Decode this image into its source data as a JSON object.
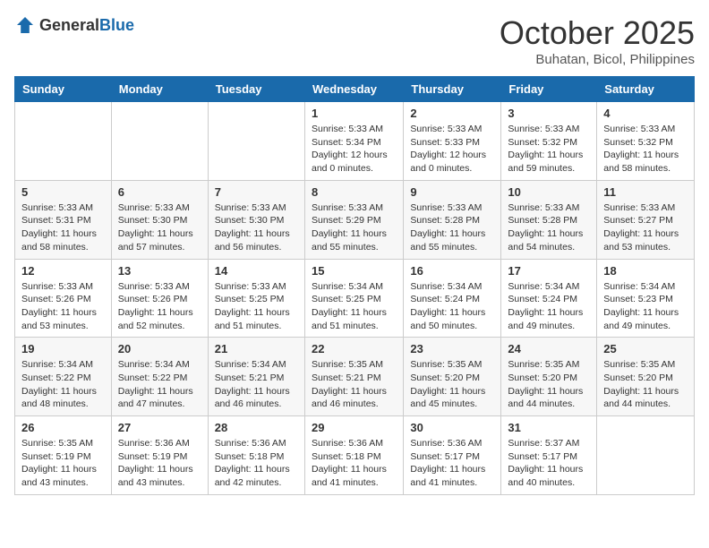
{
  "header": {
    "logo_general": "General",
    "logo_blue": "Blue",
    "month": "October 2025",
    "location": "Buhatan, Bicol, Philippines"
  },
  "weekdays": [
    "Sunday",
    "Monday",
    "Tuesday",
    "Wednesday",
    "Thursday",
    "Friday",
    "Saturday"
  ],
  "weeks": [
    [
      null,
      null,
      null,
      {
        "day": 1,
        "sunrise": "5:33 AM",
        "sunset": "5:34 PM",
        "daylight": "12 hours and 0 minutes"
      },
      {
        "day": 2,
        "sunrise": "5:33 AM",
        "sunset": "5:33 PM",
        "daylight": "12 hours and 0 minutes"
      },
      {
        "day": 3,
        "sunrise": "5:33 AM",
        "sunset": "5:32 PM",
        "daylight": "11 hours and 59 minutes"
      },
      {
        "day": 4,
        "sunrise": "5:33 AM",
        "sunset": "5:32 PM",
        "daylight": "11 hours and 58 minutes"
      }
    ],
    [
      {
        "day": 5,
        "sunrise": "5:33 AM",
        "sunset": "5:31 PM",
        "daylight": "11 hours and 58 minutes"
      },
      {
        "day": 6,
        "sunrise": "5:33 AM",
        "sunset": "5:30 PM",
        "daylight": "11 hours and 57 minutes"
      },
      {
        "day": 7,
        "sunrise": "5:33 AM",
        "sunset": "5:30 PM",
        "daylight": "11 hours and 56 minutes"
      },
      {
        "day": 8,
        "sunrise": "5:33 AM",
        "sunset": "5:29 PM",
        "daylight": "11 hours and 55 minutes"
      },
      {
        "day": 9,
        "sunrise": "5:33 AM",
        "sunset": "5:28 PM",
        "daylight": "11 hours and 55 minutes"
      },
      {
        "day": 10,
        "sunrise": "5:33 AM",
        "sunset": "5:28 PM",
        "daylight": "11 hours and 54 minutes"
      },
      {
        "day": 11,
        "sunrise": "5:33 AM",
        "sunset": "5:27 PM",
        "daylight": "11 hours and 53 minutes"
      }
    ],
    [
      {
        "day": 12,
        "sunrise": "5:33 AM",
        "sunset": "5:26 PM",
        "daylight": "11 hours and 53 minutes"
      },
      {
        "day": 13,
        "sunrise": "5:33 AM",
        "sunset": "5:26 PM",
        "daylight": "11 hours and 52 minutes"
      },
      {
        "day": 14,
        "sunrise": "5:33 AM",
        "sunset": "5:25 PM",
        "daylight": "11 hours and 51 minutes"
      },
      {
        "day": 15,
        "sunrise": "5:34 AM",
        "sunset": "5:25 PM",
        "daylight": "11 hours and 51 minutes"
      },
      {
        "day": 16,
        "sunrise": "5:34 AM",
        "sunset": "5:24 PM",
        "daylight": "11 hours and 50 minutes"
      },
      {
        "day": 17,
        "sunrise": "5:34 AM",
        "sunset": "5:24 PM",
        "daylight": "11 hours and 49 minutes"
      },
      {
        "day": 18,
        "sunrise": "5:34 AM",
        "sunset": "5:23 PM",
        "daylight": "11 hours and 49 minutes"
      }
    ],
    [
      {
        "day": 19,
        "sunrise": "5:34 AM",
        "sunset": "5:22 PM",
        "daylight": "11 hours and 48 minutes"
      },
      {
        "day": 20,
        "sunrise": "5:34 AM",
        "sunset": "5:22 PM",
        "daylight": "11 hours and 47 minutes"
      },
      {
        "day": 21,
        "sunrise": "5:34 AM",
        "sunset": "5:21 PM",
        "daylight": "11 hours and 46 minutes"
      },
      {
        "day": 22,
        "sunrise": "5:35 AM",
        "sunset": "5:21 PM",
        "daylight": "11 hours and 46 minutes"
      },
      {
        "day": 23,
        "sunrise": "5:35 AM",
        "sunset": "5:20 PM",
        "daylight": "11 hours and 45 minutes"
      },
      {
        "day": 24,
        "sunrise": "5:35 AM",
        "sunset": "5:20 PM",
        "daylight": "11 hours and 44 minutes"
      },
      {
        "day": 25,
        "sunrise": "5:35 AM",
        "sunset": "5:20 PM",
        "daylight": "11 hours and 44 minutes"
      }
    ],
    [
      {
        "day": 26,
        "sunrise": "5:35 AM",
        "sunset": "5:19 PM",
        "daylight": "11 hours and 43 minutes"
      },
      {
        "day": 27,
        "sunrise": "5:36 AM",
        "sunset": "5:19 PM",
        "daylight": "11 hours and 43 minutes"
      },
      {
        "day": 28,
        "sunrise": "5:36 AM",
        "sunset": "5:18 PM",
        "daylight": "11 hours and 42 minutes"
      },
      {
        "day": 29,
        "sunrise": "5:36 AM",
        "sunset": "5:18 PM",
        "daylight": "11 hours and 41 minutes"
      },
      {
        "day": 30,
        "sunrise": "5:36 AM",
        "sunset": "5:17 PM",
        "daylight": "11 hours and 41 minutes"
      },
      {
        "day": 31,
        "sunrise": "5:37 AM",
        "sunset": "5:17 PM",
        "daylight": "11 hours and 40 minutes"
      },
      null
    ]
  ]
}
